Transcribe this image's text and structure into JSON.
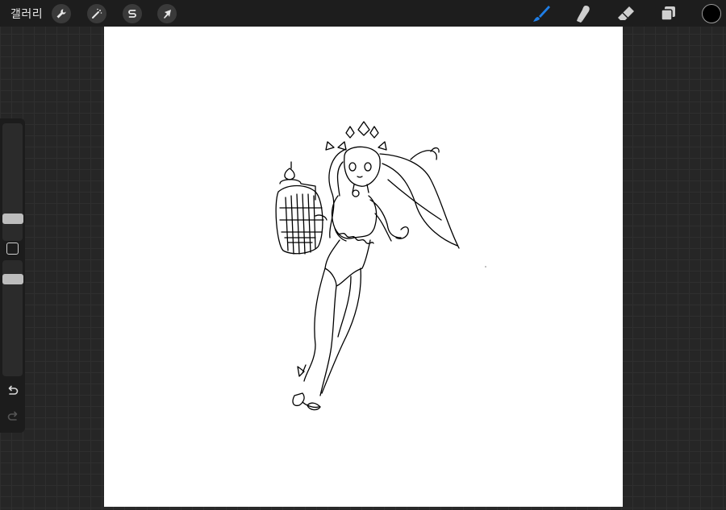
{
  "topbar": {
    "gallery_label": "갤러리",
    "left_tools": [
      {
        "name": "actions",
        "icon": "wrench-icon"
      },
      {
        "name": "adjustments",
        "icon": "magic-wand-icon"
      },
      {
        "name": "selection",
        "icon": "selection-s-icon"
      },
      {
        "name": "transform",
        "icon": "arrow-cursor-icon"
      }
    ],
    "right_tools": [
      {
        "name": "brush",
        "icon": "brush-icon",
        "active": true
      },
      {
        "name": "smudge",
        "icon": "smudge-icon",
        "active": false
      },
      {
        "name": "eraser",
        "icon": "eraser-icon",
        "active": false
      },
      {
        "name": "layers",
        "icon": "layers-icon",
        "active": false
      }
    ],
    "current_color": "#000000",
    "active_tool_color": "#1f7ee6"
  },
  "sidebar": {
    "brush_size_level": 0.64,
    "opacity_level": 0.41,
    "modifier": "square-modifier-icon",
    "undo": "undo-icon",
    "redo": "redo-icon"
  },
  "canvas": {
    "background": "#ffffff",
    "content": "line-art-character-drawing"
  }
}
